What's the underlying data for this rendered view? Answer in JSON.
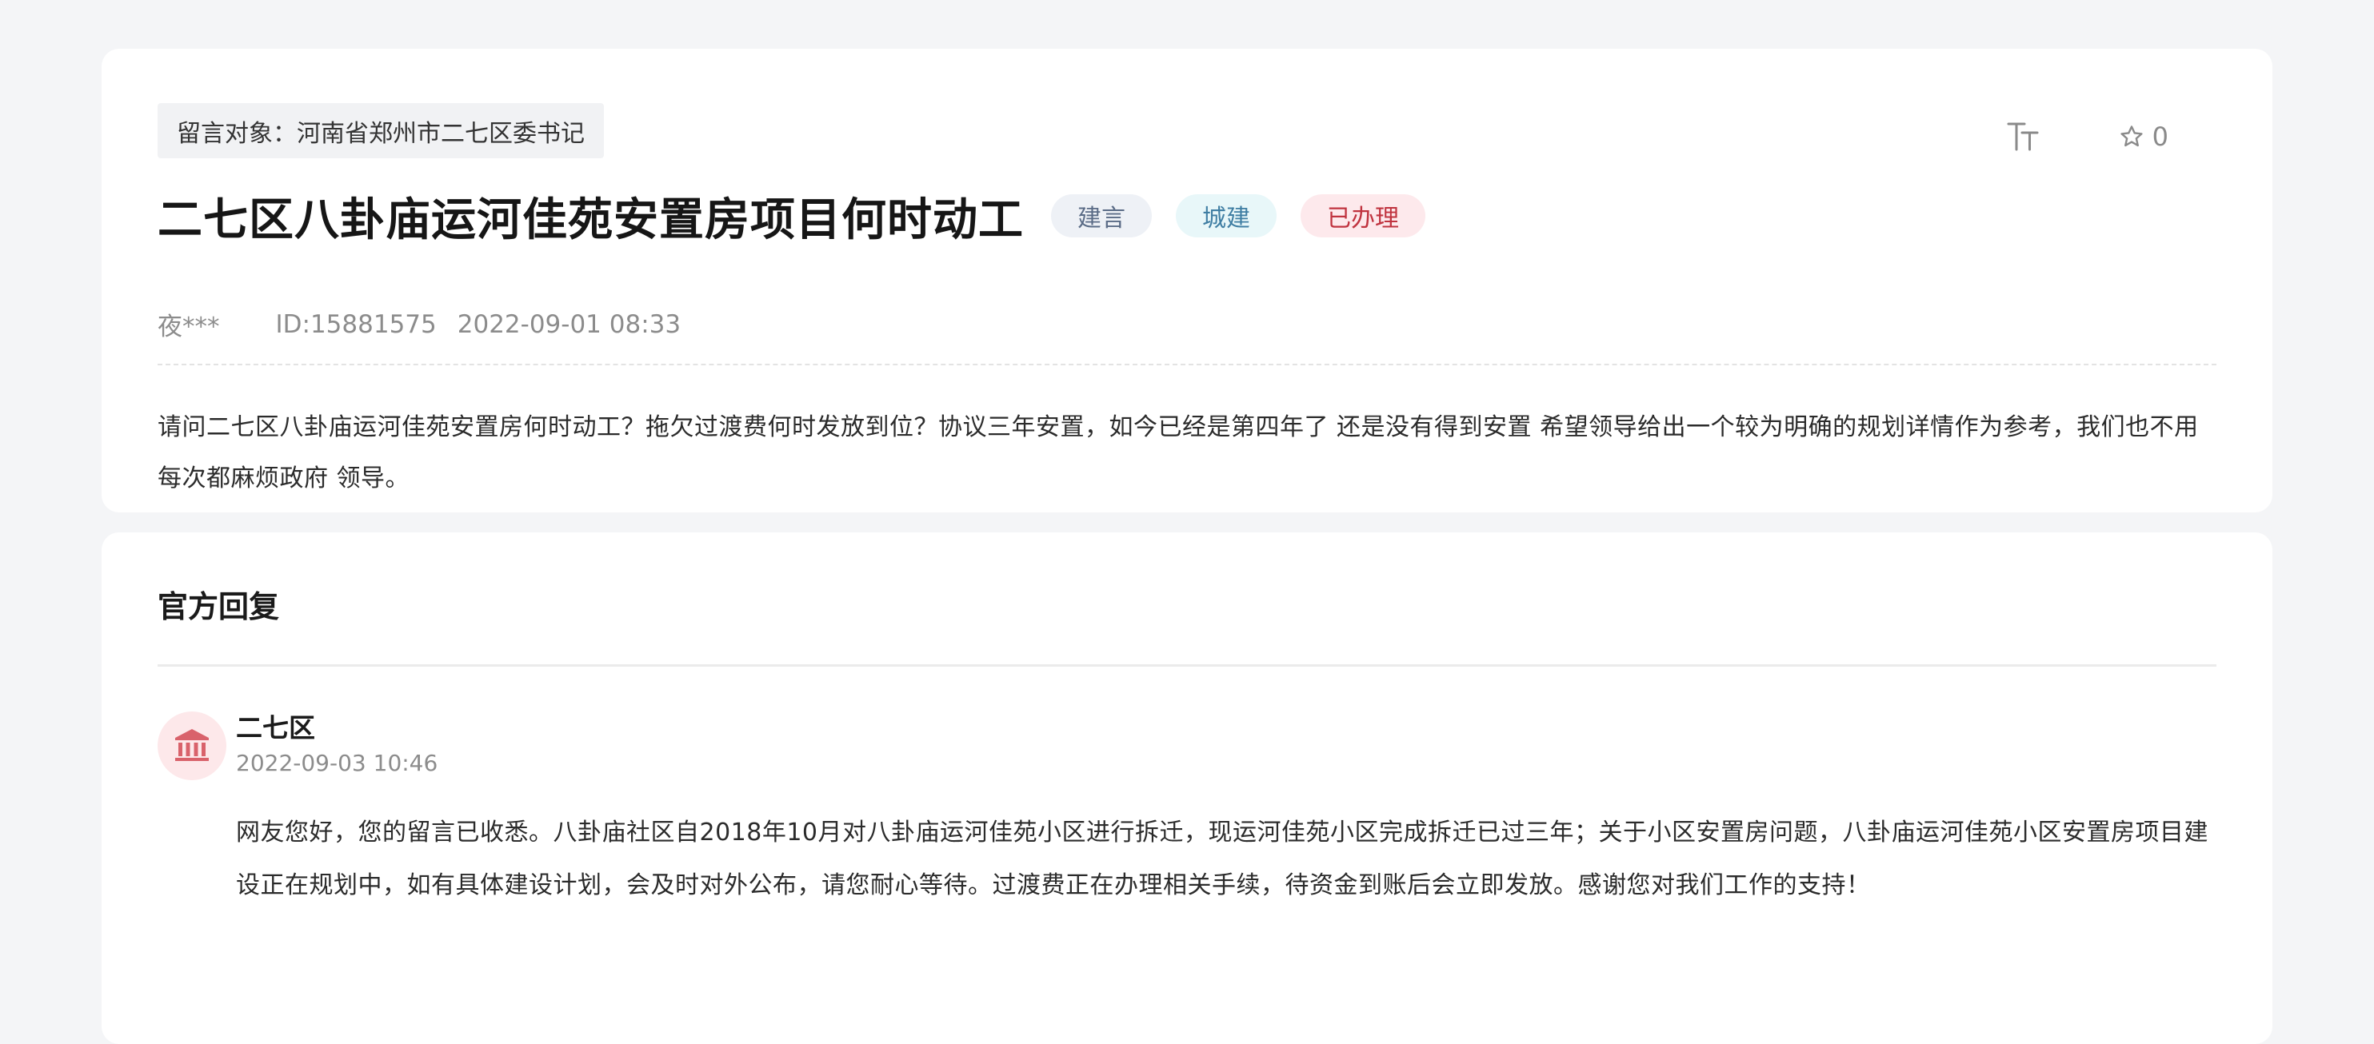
{
  "question": {
    "target_label": "留言对象：河南省郑州市二七区委书记",
    "title": "二七区八卦庙运河佳苑安置房项目何时动工",
    "tags": [
      {
        "label": "建言",
        "color": "#5a6b86"
      },
      {
        "label": "城建",
        "color": "#3f7ea3"
      },
      {
        "label": "已办理",
        "color": "#c0333f"
      }
    ],
    "author": "夜***",
    "id_text": "ID:15881575",
    "datetime": "2022-09-01 08:33",
    "body": "请问二七区八卦庙运河佳苑安置房何时动工？拖欠过渡费何时发放到位？协议三年安置，如今已经是第四年了 还是没有得到安置 希望领导给出一个较为明确的规划详情作为参考，我们也不用每次都麻烦政府 领导。",
    "favorite_count": "0",
    "icons": {
      "font_size": "text-size-icon",
      "favorite": "star-outline-icon"
    }
  },
  "reply": {
    "heading": "官方回复",
    "responder": "二七区",
    "datetime": "2022-09-03 10:46",
    "avatar_icon": "government-building-icon",
    "body": "网友您好，您的留言已收悉。八卦庙社区自2018年10月对八卦庙运河佳苑小区进行拆迁，现运河佳苑小区完成拆迁已过三年；关于小区安置房问题，八卦庙运河佳苑小区安置房项目建设正在规划中，如有具体建设计划，会及时对外公布，请您耐心等待。过渡费正在办理相关手续，待资金到账后会立即发放。感谢您对我们工作的支持！"
  },
  "colors": {
    "page_background": "#f4f5f7",
    "card_background": "#ffffff",
    "avatar_background": "#fde8ea",
    "avatar_icon": "#d9626b"
  }
}
